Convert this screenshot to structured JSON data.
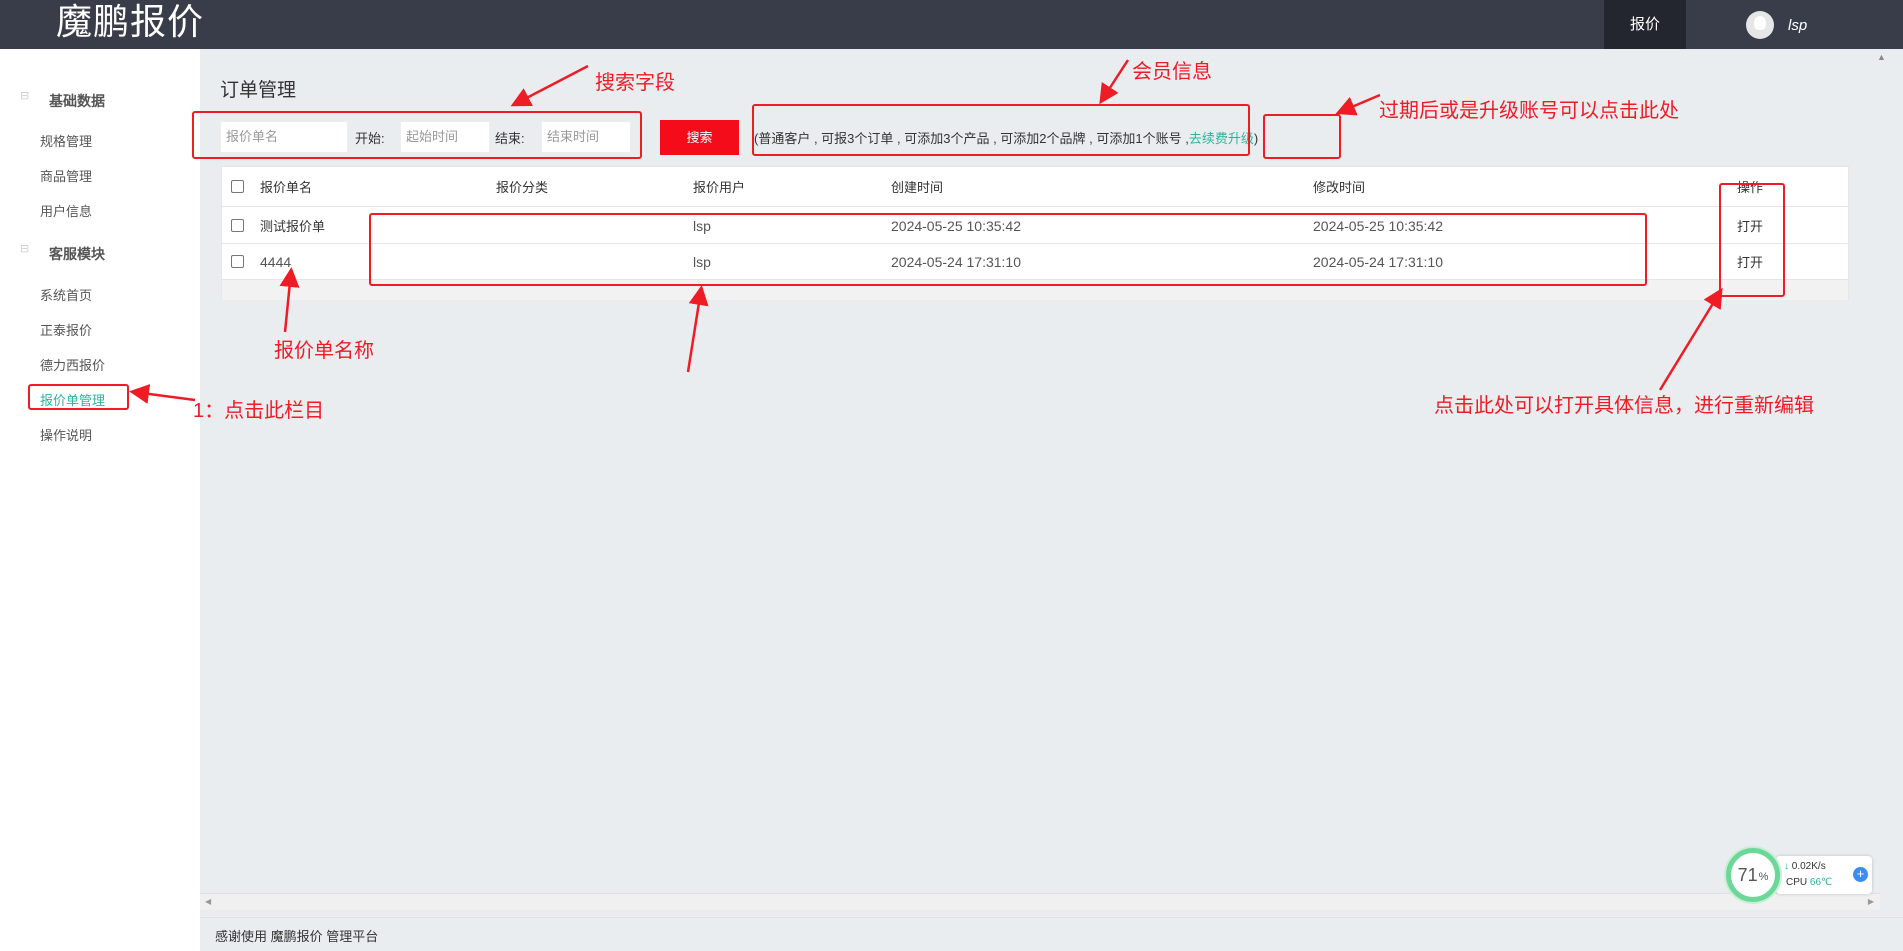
{
  "header": {
    "logo": "魔鹏报价",
    "nav_quote": "报价",
    "user_name": "lsp"
  },
  "sidebar": {
    "groups": [
      {
        "title": "基础数据",
        "items": [
          "规格管理",
          "商品管理",
          "用户信息"
        ]
      },
      {
        "title": "客服模块",
        "items": [
          "系统首页",
          "正泰报价",
          "德力西报价",
          "报价单管理",
          "操作说明"
        ]
      }
    ],
    "active_item": "报价单管理"
  },
  "page": {
    "title": "订单管理"
  },
  "search": {
    "name_placeholder": "报价单名",
    "start_label": "开始:",
    "start_placeholder": "起始时间",
    "end_label": "结束:",
    "end_placeholder": "结束时间",
    "button": "搜索"
  },
  "member_info": {
    "prefix": "(",
    "text": "普通客户 , 可报3个订单 , 可添加3个产品 , 可添加2个品牌 , 可添加1个账号 ,",
    "renew_link": "去续费升级",
    "suffix": ")"
  },
  "table": {
    "columns": [
      "报价单名",
      "报价分类",
      "报价用户",
      "创建时间",
      "修改时间",
      "操作"
    ],
    "rows": [
      {
        "name": "测试报价单",
        "category": "",
        "user": "lsp",
        "created": "2024-05-25 10:35:42",
        "modified": "2024-05-25 10:35:42",
        "action": "打开"
      },
      {
        "name": "4444",
        "category": "",
        "user": "lsp",
        "created": "2024-05-24 17:31:10",
        "modified": "2024-05-24 17:31:10",
        "action": "打开"
      }
    ]
  },
  "annotations": {
    "search_field": "搜索字段",
    "member_info": "会员信息",
    "upgrade_hint": "过期后或是升级账号可以点击此处",
    "quote_name": "报价单名称",
    "click_menu": "1：点击此栏目",
    "open_hint": "点击此处可以打开具体信息，进行重新编辑"
  },
  "footer": {
    "text": "感谢使用 魔鹏报价 管理平台"
  },
  "widget": {
    "percent": "71",
    "percent_unit": "%",
    "net_speed": "0.02K/s",
    "cpu_label": "CPU",
    "cpu_temp": "66℃"
  },
  "colors": {
    "header_bg": "#393d49",
    "accent": "#2fb39a",
    "search_button": "#f50c1a",
    "annotation_red": "#ee1c25"
  }
}
